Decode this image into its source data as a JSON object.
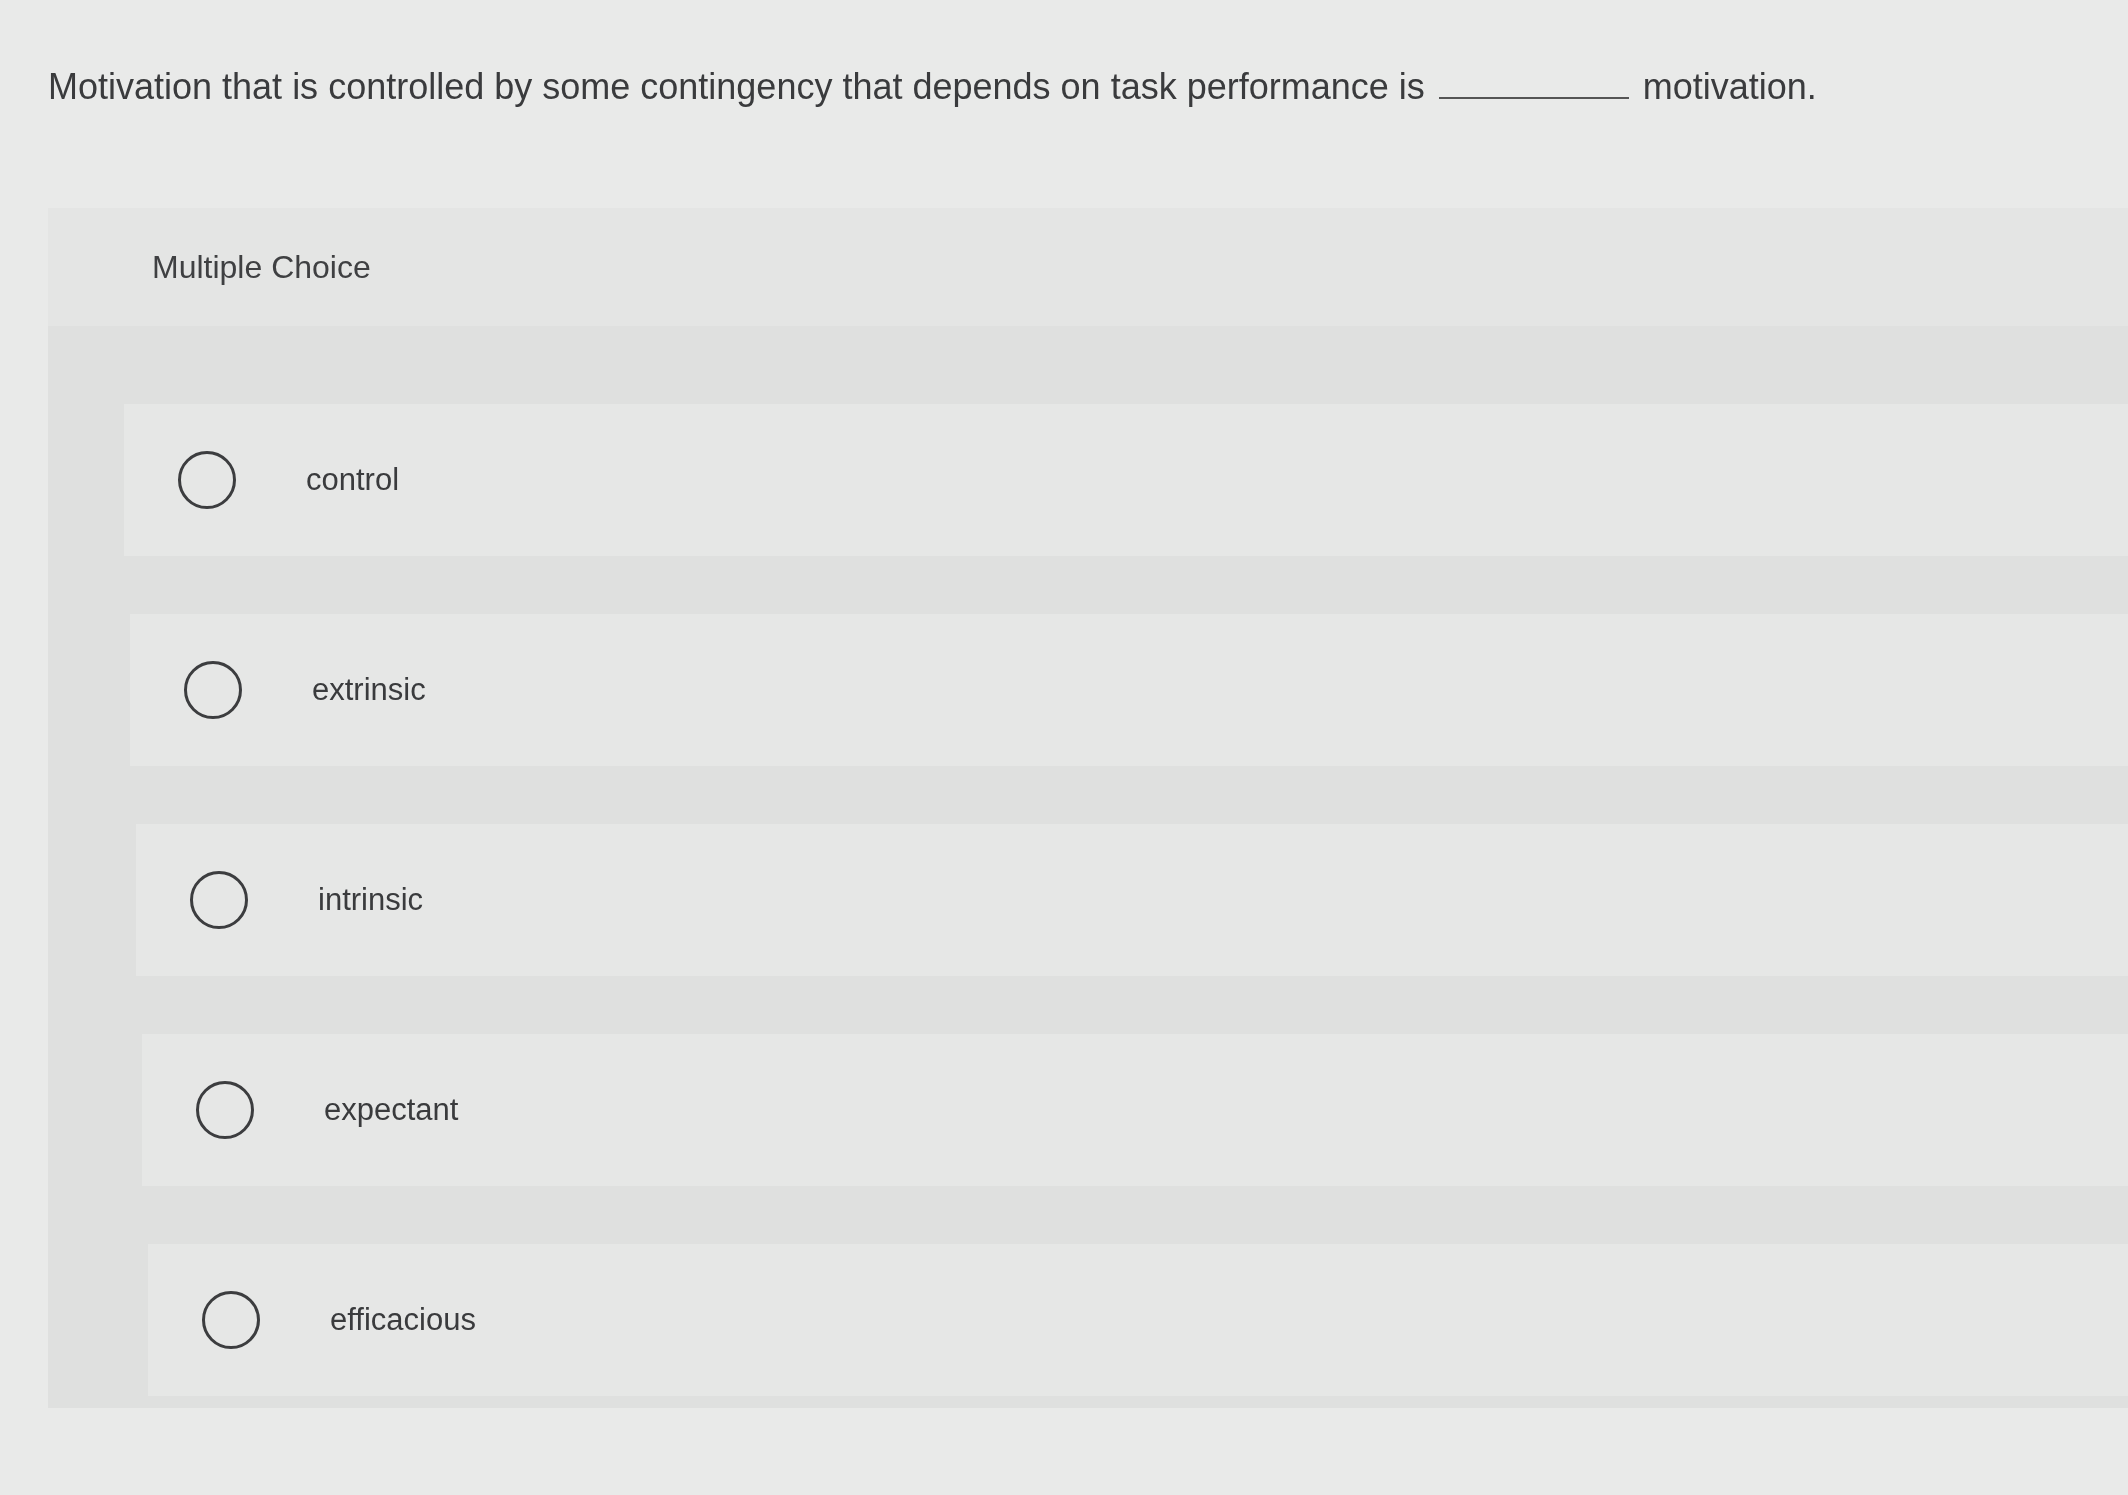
{
  "question": {
    "text_before": "Motivation that is controlled by some contingency that depends on task performance is",
    "text_after": "motivation."
  },
  "panel": {
    "heading": "Multiple Choice"
  },
  "options": [
    {
      "label": "control",
      "selected": false
    },
    {
      "label": "extrinsic",
      "selected": false
    },
    {
      "label": "intrinsic",
      "selected": false
    },
    {
      "label": "expectant",
      "selected": false
    },
    {
      "label": "efficacious",
      "selected": false
    }
  ]
}
